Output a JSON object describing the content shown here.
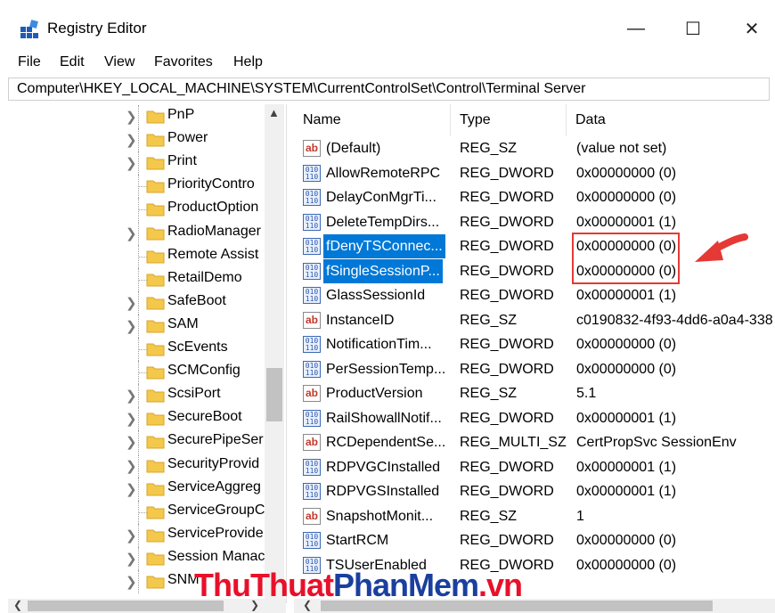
{
  "window": {
    "title": "Registry Editor",
    "minimize": "—",
    "maximize": "☐",
    "close": "✕"
  },
  "menu": [
    "File",
    "Edit",
    "View",
    "Favorites",
    "Help"
  ],
  "address": "Computer\\HKEY_LOCAL_MACHINE\\SYSTEM\\CurrentControlSet\\Control\\Terminal Server",
  "tree": [
    {
      "label": "PnP",
      "expandable": true
    },
    {
      "label": "Power",
      "expandable": true
    },
    {
      "label": "Print",
      "expandable": true
    },
    {
      "label": "PriorityContro",
      "expandable": false
    },
    {
      "label": "ProductOption",
      "expandable": false
    },
    {
      "label": "RadioManager",
      "expandable": true
    },
    {
      "label": "Remote Assist",
      "expandable": false
    },
    {
      "label": "RetailDemo",
      "expandable": false
    },
    {
      "label": "SafeBoot",
      "expandable": true
    },
    {
      "label": "SAM",
      "expandable": true
    },
    {
      "label": "ScEvents",
      "expandable": false
    },
    {
      "label": "SCMConfig",
      "expandable": false
    },
    {
      "label": "ScsiPort",
      "expandable": true
    },
    {
      "label": "SecureBoot",
      "expandable": true
    },
    {
      "label": "SecurePipeSer",
      "expandable": true
    },
    {
      "label": "SecurityProvid",
      "expandable": true
    },
    {
      "label": "ServiceAggreg",
      "expandable": true
    },
    {
      "label": "ServiceGroupC",
      "expandable": false
    },
    {
      "label": "ServiceProvide",
      "expandable": true
    },
    {
      "label": "Session Manac",
      "expandable": true
    },
    {
      "label": "SNM",
      "expandable": true
    }
  ],
  "columns": {
    "name": "Name",
    "type": "Type",
    "data": "Data"
  },
  "values": [
    {
      "icon": "ab",
      "name": "(Default)",
      "type": "REG_SZ",
      "data": "(value not set)",
      "selected": false
    },
    {
      "icon": "bin",
      "name": "AllowRemoteRPC",
      "type": "REG_DWORD",
      "data": "0x00000000 (0)",
      "selected": false
    },
    {
      "icon": "bin",
      "name": "DelayConMgrTi...",
      "type": "REG_DWORD",
      "data": "0x00000000 (0)",
      "selected": false
    },
    {
      "icon": "bin",
      "name": "DeleteTempDirs...",
      "type": "REG_DWORD",
      "data": "0x00000001 (1)",
      "selected": false
    },
    {
      "icon": "bin",
      "name": "fDenyTSConnec...",
      "type": "REG_DWORD",
      "data": "0x00000000 (0)",
      "selected": true
    },
    {
      "icon": "bin",
      "name": "fSingleSessionP...",
      "type": "REG_DWORD",
      "data": "0x00000000 (0)",
      "selected": true
    },
    {
      "icon": "bin",
      "name": "GlassSessionId",
      "type": "REG_DWORD",
      "data": "0x00000001 (1)",
      "selected": false
    },
    {
      "icon": "ab",
      "name": "InstanceID",
      "type": "REG_SZ",
      "data": "c0190832-4f93-4dd6-a0a4-338",
      "selected": false
    },
    {
      "icon": "bin",
      "name": "NotificationTim...",
      "type": "REG_DWORD",
      "data": "0x00000000 (0)",
      "selected": false
    },
    {
      "icon": "bin",
      "name": "PerSessionTemp...",
      "type": "REG_DWORD",
      "data": "0x00000000 (0)",
      "selected": false
    },
    {
      "icon": "ab",
      "name": "ProductVersion",
      "type": "REG_SZ",
      "data": "5.1",
      "selected": false
    },
    {
      "icon": "bin",
      "name": "RailShowallNotif...",
      "type": "REG_DWORD",
      "data": "0x00000001 (1)",
      "selected": false
    },
    {
      "icon": "ab",
      "name": "RCDependentSe...",
      "type": "REG_MULTI_SZ",
      "data": "CertPropSvc SessionEnv",
      "selected": false
    },
    {
      "icon": "bin",
      "name": "RDPVGCInstalled",
      "type": "REG_DWORD",
      "data": "0x00000001 (1)",
      "selected": false
    },
    {
      "icon": "bin",
      "name": "RDPVGSInstalled",
      "type": "REG_DWORD",
      "data": "0x00000001 (1)",
      "selected": false
    },
    {
      "icon": "ab",
      "name": "SnapshotMonit...",
      "type": "REG_SZ",
      "data": "1",
      "selected": false
    },
    {
      "icon": "bin",
      "name": "StartRCM",
      "type": "REG_DWORD",
      "data": "0x00000000 (0)",
      "selected": false
    },
    {
      "icon": "bin",
      "name": "TSUserEnabled",
      "type": "REG_DWORD",
      "data": "0x00000000 (0)",
      "selected": false
    }
  ],
  "watermark": {
    "part1": "ThuThuat",
    "part2": "PhanMem",
    "part3": ".vn"
  },
  "colors": {
    "selection": "#0078d7",
    "annotation": "#e53935",
    "folder": "#f4c84a",
    "watermark_red": "#e8102a",
    "watermark_blue": "#1a3f9e"
  }
}
